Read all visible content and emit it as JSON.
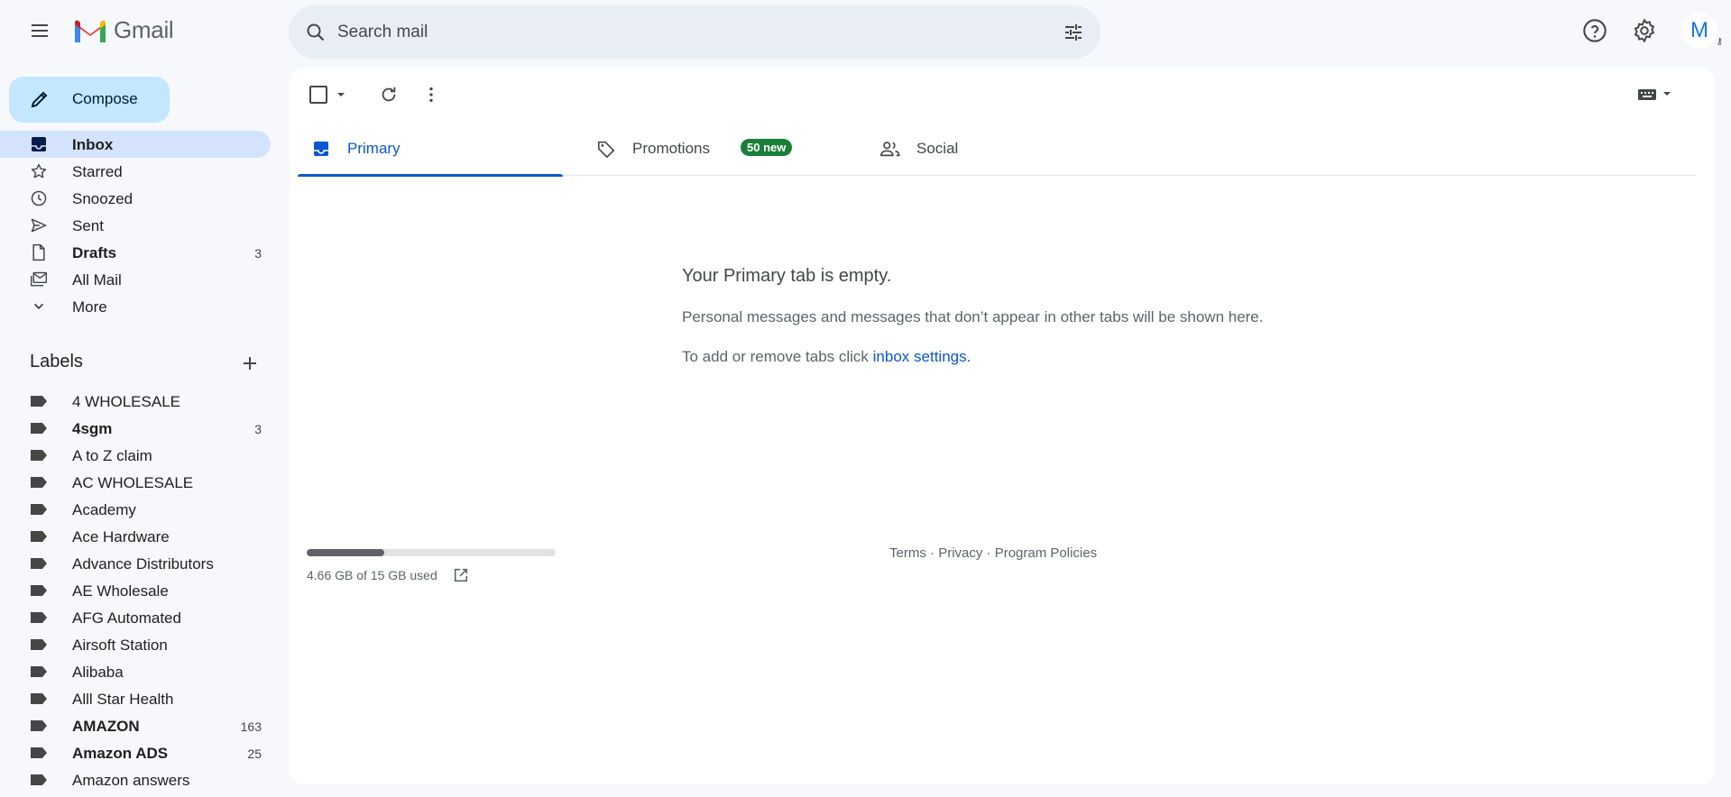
{
  "header": {
    "app_name": "Gmail",
    "search_placeholder": "Search mail",
    "avatar_initial": "M"
  },
  "compose": {
    "label": "Compose"
  },
  "nav": [
    {
      "label": "Inbox",
      "count": "",
      "icon": "inbox-icon",
      "active": true,
      "bold": true
    },
    {
      "label": "Starred",
      "count": "",
      "icon": "star-icon",
      "active": false,
      "bold": false
    },
    {
      "label": "Snoozed",
      "count": "",
      "icon": "clock-icon",
      "active": false,
      "bold": false
    },
    {
      "label": "Sent",
      "count": "",
      "icon": "send-icon",
      "active": false,
      "bold": false
    },
    {
      "label": "Drafts",
      "count": "3",
      "icon": "draft-icon",
      "active": false,
      "bold": true
    },
    {
      "label": "All Mail",
      "count": "",
      "icon": "all-mail-icon",
      "active": false,
      "bold": false
    },
    {
      "label": "More",
      "count": "",
      "icon": "chevron-down-icon",
      "active": false,
      "bold": false
    }
  ],
  "labels_section": {
    "title": "Labels"
  },
  "labels": [
    {
      "label": "4 WHOLESALE",
      "count": "",
      "bold": false
    },
    {
      "label": "4sgm",
      "count": "3",
      "bold": true
    },
    {
      "label": "A to Z claim",
      "count": "",
      "bold": false
    },
    {
      "label": "AC WHOLESALE",
      "count": "",
      "bold": false
    },
    {
      "label": "Academy",
      "count": "",
      "bold": false
    },
    {
      "label": "Ace Hardware",
      "count": "",
      "bold": false
    },
    {
      "label": "Advance Distributors",
      "count": "",
      "bold": false
    },
    {
      "label": "AE Wholesale",
      "count": "",
      "bold": false
    },
    {
      "label": "AFG Automated",
      "count": "",
      "bold": false
    },
    {
      "label": "Airsoft Station",
      "count": "",
      "bold": false
    },
    {
      "label": "Alibaba",
      "count": "",
      "bold": false
    },
    {
      "label": "Alll Star Health",
      "count": "",
      "bold": false
    },
    {
      "label": "AMAZON",
      "count": "163",
      "bold": true
    },
    {
      "label": "Amazon ADS",
      "count": "25",
      "bold": true
    },
    {
      "label": "Amazon answers",
      "count": "",
      "bold": false
    }
  ],
  "tabs": [
    {
      "label": "Primary",
      "icon": "inbox-tab-icon",
      "active": true,
      "badge": ""
    },
    {
      "label": "Promotions",
      "icon": "tag-icon",
      "active": false,
      "badge": "50 new"
    },
    {
      "label": "Social",
      "icon": "people-icon",
      "active": false,
      "badge": ""
    }
  ],
  "empty_state": {
    "title": "Your Primary tab is empty.",
    "description": "Personal messages and messages that don’t appear in other tabs will be shown here.",
    "tip_prefix": "To add or remove tabs click ",
    "tip_link": "inbox settings."
  },
  "storage": {
    "text": "4.66 GB of 15 GB used",
    "used_fraction": 0.31
  },
  "footer": {
    "terms": "Terms",
    "privacy": "Privacy",
    "program_policies": "Program Policies",
    "separator": " · "
  },
  "colors": {
    "accent": "#0b57d0",
    "compose_bg": "#c2e7ff",
    "active_nav_bg": "#d3e3fd",
    "badge_green": "#188038",
    "page_bg": "#f6f8fc"
  }
}
